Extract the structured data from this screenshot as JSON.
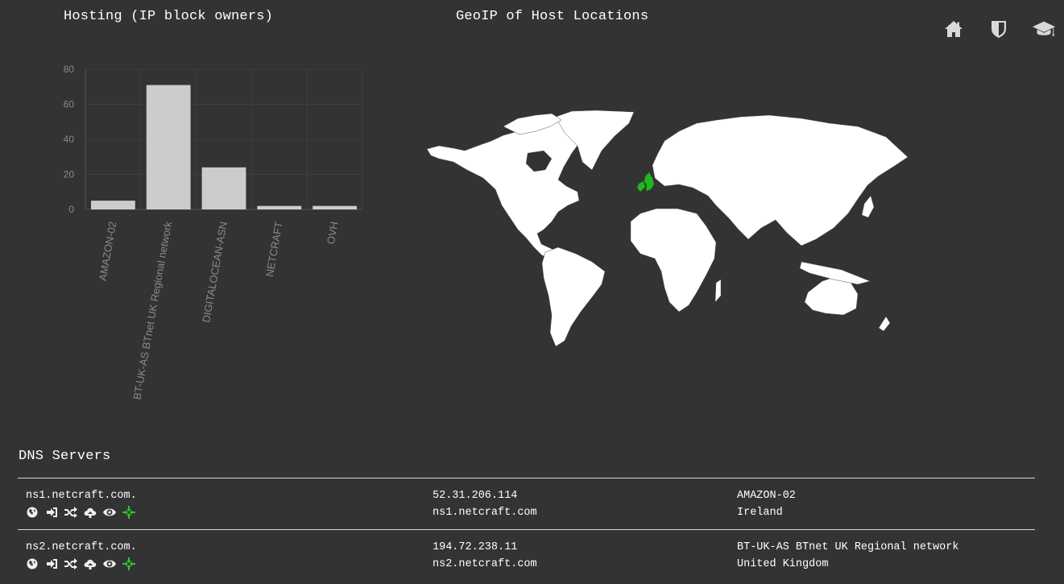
{
  "hosting": {
    "title": "Hosting (IP block owners)"
  },
  "geoip": {
    "title": "GeoIP of Host Locations",
    "highlight_color": "#22b822"
  },
  "nav": {
    "icons": [
      "home-icon",
      "shield-icon",
      "graduation-cap-icon"
    ]
  },
  "chart_data": {
    "type": "bar",
    "categories": [
      "AMAZON-02",
      "BT-UK-AS BTnet UK Regional network",
      "DIGITALOCEAN-ASN",
      "NETCRAFT",
      "OVH"
    ],
    "values": [
      5,
      71,
      24,
      2,
      2
    ],
    "yticks": [
      "0",
      "20",
      "40",
      "60",
      "80"
    ],
    "ylim": [
      0,
      80
    ],
    "grid": true,
    "bar_color": "#cccccc",
    "title": "",
    "xlabel": "",
    "ylabel": ""
  },
  "dns": {
    "title": "DNS Servers",
    "rows": [
      {
        "hostname": "ns1.netcraft.com.",
        "ip": "52.31.206.114",
        "reverse": "ns1.netcraft.com",
        "asn": "AMAZON-02",
        "country": "Ireland"
      },
      {
        "hostname": "ns2.netcraft.com.",
        "ip": "194.72.238.11",
        "reverse": "ns2.netcraft.com",
        "asn": "BT-UK-AS BTnet UK Regional network",
        "country": "United Kingdom"
      }
    ],
    "row_icons": [
      "globe-icon",
      "sign-in-icon",
      "random-icon",
      "cloud-upload-icon",
      "eye-icon",
      "crosshairs-icon"
    ]
  }
}
